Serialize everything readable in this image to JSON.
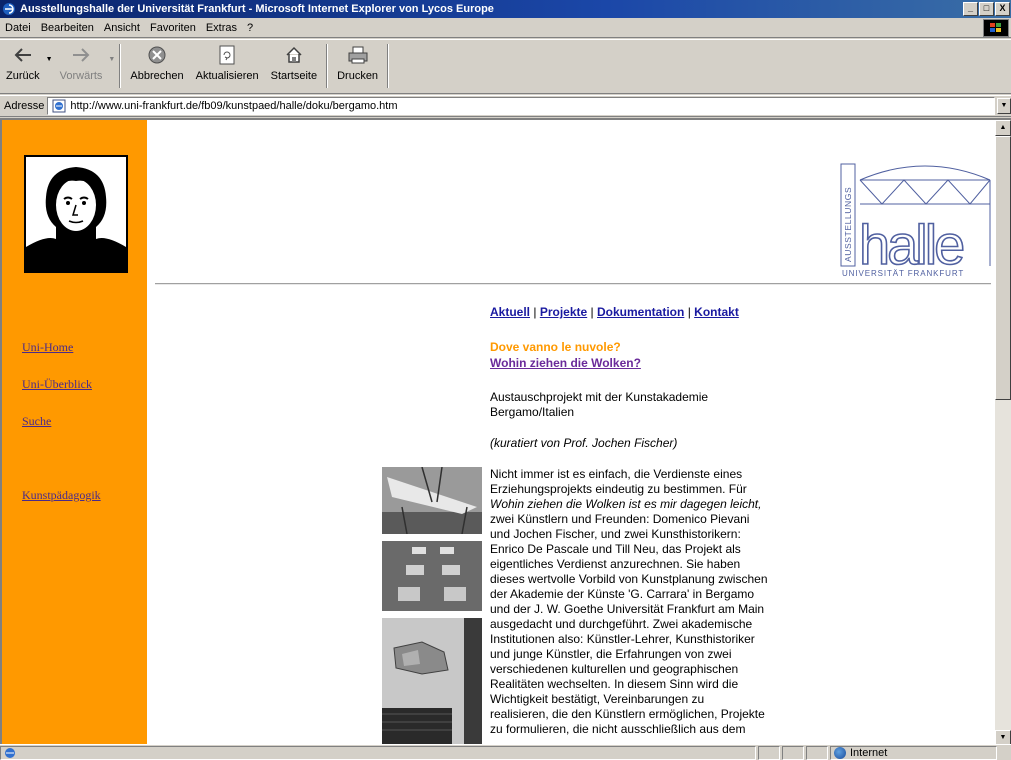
{
  "window": {
    "title": "Ausstellungshalle der Universität Frankfurt - Microsoft Internet Explorer von Lycos Europe",
    "controls": [
      "_",
      "□",
      "X"
    ]
  },
  "menu": [
    "Datei",
    "Bearbeiten",
    "Ansicht",
    "Favoriten",
    "Extras",
    "?"
  ],
  "toolbar": {
    "back": "Zurück",
    "forward": "Vorwärts",
    "stop": "Abbrechen",
    "refresh": "Aktualisieren",
    "home": "Startseite",
    "print": "Drucken"
  },
  "address": {
    "label": "Adresse",
    "url": "http://www.uni-frankfurt.de/fb09/kunstpaed/halle/doku/bergamo.htm"
  },
  "sidebar": {
    "links": [
      "Uni-Home",
      "Uni-Überblick",
      "Suche",
      "Kunstpädagogik"
    ]
  },
  "logo": {
    "side_text": "AUSSTELLUNGS",
    "word": "halle",
    "subtitle": "UNIVERSITÄT FRANKFURT"
  },
  "nav": {
    "items": [
      "Aktuell",
      "Projekte",
      "Dokumentation",
      "Kontakt"
    ],
    "separator": "|"
  },
  "article": {
    "title_it": "Dove vanno le nuvole?",
    "title_de": "Wohin ziehen die Wolken?",
    "intro": "Austauschprojekt mit der Kunstakademie Bergamo/Italien",
    "curator": "(kuratiert von Prof. Jochen Fischer)",
    "body_lines": [
      "Nicht immer ist es einfach, die Verdienste eines",
      "Erziehungsprojekts eindeutig zu bestimmen. Für",
      "Wohin ziehen die Wolken ist es mir dagegen leicht,",
      "zwei Künstlern und Freunden: Domenico Pievani",
      "und Jochen Fischer, und zwei Kunsthistorikern:",
      "Enrico De Pascale und Till Neu, das Projekt als",
      "eigentliches Verdienst anzurechnen. Sie haben",
      "dieses wertvolle Vorbild von Kunstplanung zwischen",
      "der Akademie der Künste 'G. Carrara' in Bergamo",
      "und der J. W. Goethe Universität Frankfurt am Main",
      "ausgedacht und durchgeführt. Zwei akademische",
      "Institutionen also: Künstler-Lehrer, Kunsthistoriker",
      "und junge Künstler, die Erfahrungen von zwei",
      "verschiedenen kulturellen und geographischen",
      "Realitäten wechselten. In diesem Sinn wird die",
      "Wichtigkeit bestätigt, Vereinbarungen zu",
      "realisieren, die den Künstlern ermöglichen, Projekte",
      "zu formulieren, die nicht ausschließlich aus dem"
    ]
  },
  "status": {
    "zone": "Internet"
  }
}
